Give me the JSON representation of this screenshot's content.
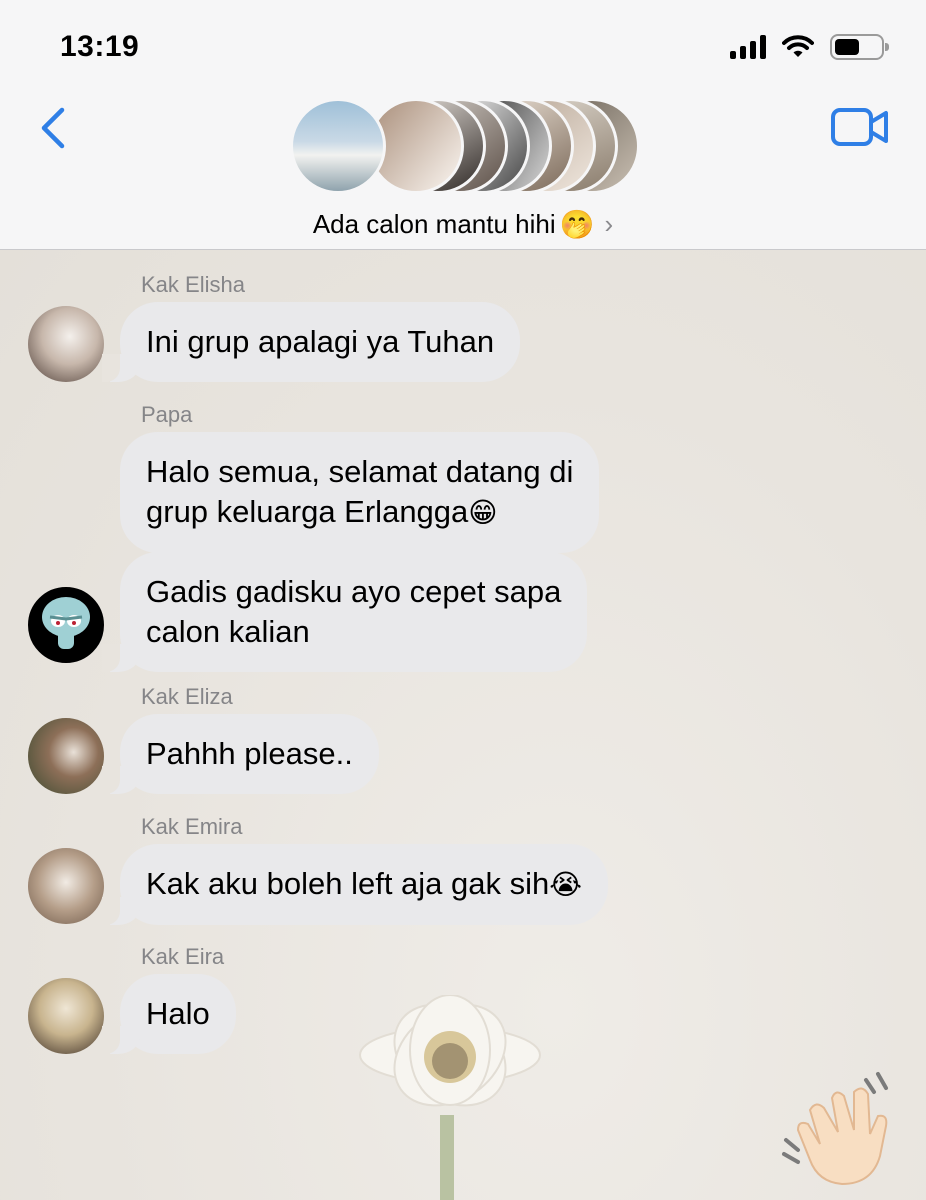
{
  "status_bar": {
    "time": "13:19",
    "battery_level": 0.55
  },
  "header": {
    "back_icon": "chevron-left-icon",
    "video_icon": "video-camera-icon",
    "group_name": "Ada calon mantu hihi",
    "group_name_emoji": "🤭",
    "chevron": "›",
    "accent_color": "#2f7fe6"
  },
  "messages": [
    {
      "sender": "Kak Elisha",
      "text": "Ini grup apalagi ya Tuhan",
      "emoji": ""
    },
    {
      "sender": "Papa",
      "text": "Halo semua, selamat datang di\ngrup keluarga Erlangga",
      "emoji": "😁"
    },
    {
      "sender": "",
      "text": "Gadis gadisku ayo cepet sapa\ncalon kalian",
      "emoji": ""
    },
    {
      "sender": "Kak Eliza",
      "text": "Pahhh please..",
      "emoji": ""
    },
    {
      "sender": "Kak Emira",
      "text": "Kak aku boleh left aja gak sih",
      "emoji": "😭"
    },
    {
      "sender": "Kak Eira",
      "text": "Halo",
      "emoji": ""
    }
  ],
  "sticker": {
    "icon": "waving-hand-icon"
  }
}
